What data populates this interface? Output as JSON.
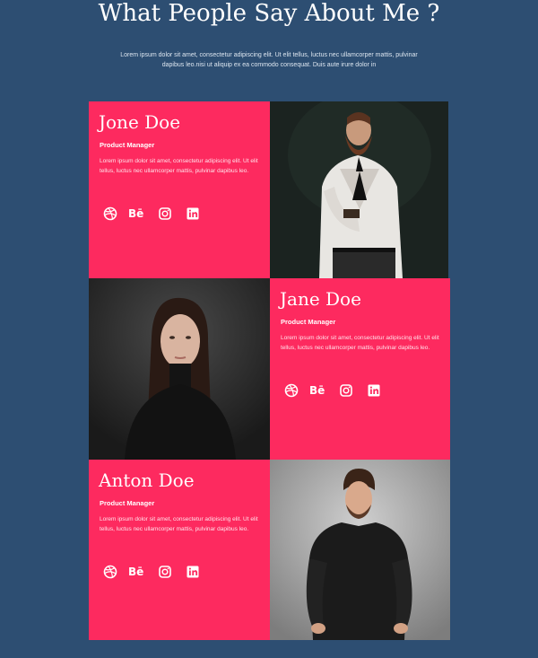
{
  "section": {
    "title": "What People Say About Me ?",
    "intro": "Lorem ipsum dolor sit amet, consectetur adipiscing elit. Ut elit tellus, luctus nec ullamcorper mattis, pulvinar dapibus leo.nisi ut aliquip ex ea commodo consequat. Duis aute irure dolor in"
  },
  "people": [
    {
      "name": "Jone Doe",
      "role": "Product Manager",
      "bio": "Lorem ipsum dolor sit amet, consectetur adipiscing elit. Ut elit tellus, luctus nec ullamcorper mattis, pulvinar dapibus leo.",
      "socials": [
        "dribbble-icon",
        "behance-icon",
        "instagram-icon",
        "linkedin-icon"
      ],
      "behance_text": "Bē"
    },
    {
      "name": "Jane Doe",
      "role": "Product Manager",
      "bio": "Lorem ipsum dolor sit amet, consectetur adipiscing elit. Ut elit tellus, luctus nec ullamcorper mattis, pulvinar dapibus leo.",
      "socials": [
        "dribbble-icon",
        "behance-icon",
        "instagram-icon",
        "linkedin-icon"
      ],
      "behance_text": "Bē"
    },
    {
      "name": "Anton Doe",
      "role": "Product Manager",
      "bio": "Lorem ipsum dolor sit amet, consectetur adipiscing elit. Ut elit tellus, luctus nec ullamcorper mattis, pulvinar dapibus leo.",
      "socials": [
        "dribbble-icon",
        "behance-icon",
        "instagram-icon",
        "linkedin-icon"
      ],
      "behance_text": "Bē"
    }
  ],
  "colors": {
    "background": "#2d4e72",
    "card": "#fd2a5f",
    "text": "#ffffff"
  }
}
